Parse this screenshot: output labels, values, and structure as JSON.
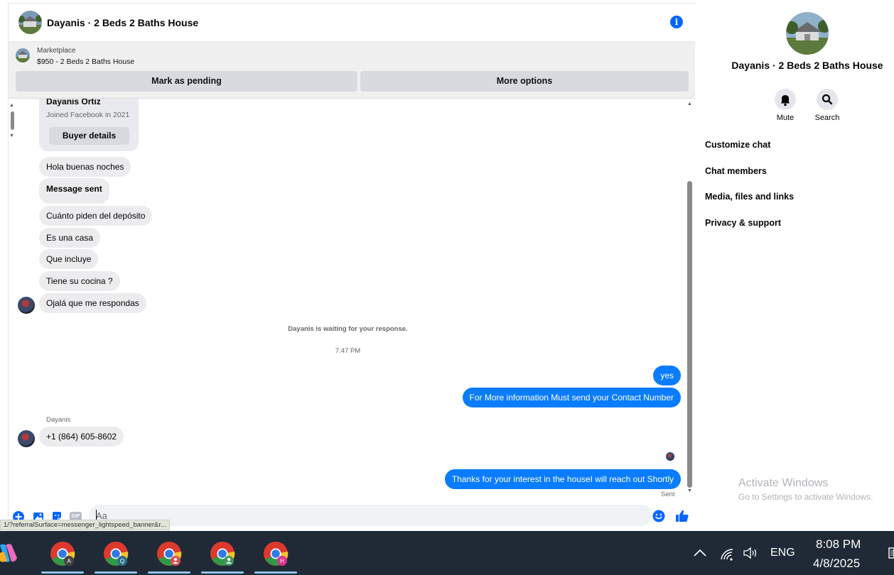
{
  "chat": {
    "title": "Dayanis · 2 Beds 2 Baths House",
    "info_icon": "i"
  },
  "marketplace": {
    "label": "Marketplace",
    "listing": "$950 - 2 Beds 2 Baths House",
    "mark_pending": "Mark as pending",
    "more_options": "More options"
  },
  "buyer_card": {
    "name": "Dayanis Ortiz",
    "joined": "Joined Facebook in 2021",
    "details_button": "Buyer details"
  },
  "messages": {
    "m1": "Hola buenas noches",
    "m2": "Message sent",
    "m3": "Cuánto piden del depósito",
    "m4": "Es una casa",
    "m5": "Que incluye",
    "m6": "Tiene su cocina ?",
    "m7": "Ojalá que me respondas",
    "waiting": "Dayanis is waiting for your response.",
    "time": "7:47 PM",
    "me1": "yes",
    "me2": "For More information Must send your Contact Number",
    "sender": "Dayanis",
    "phone": "+1 (864) 605-8602",
    "me3": "Thanks for your interest in the houseI will reach out Shortly",
    "sent": "Sent"
  },
  "composer": {
    "placeholder": "Aa",
    "gif_label": "GIF"
  },
  "status_url": "1/?referralSurface=messenger_lightspeed_banner&r...",
  "sidebar": {
    "title": "Dayanis · 2 Beds 2 Baths House",
    "mute": "Mute",
    "search": "Search",
    "items": [
      "Customize chat",
      "Chat members",
      "Media, files and links",
      "Privacy & support"
    ]
  },
  "watermark": {
    "title": "Activate Windows",
    "sub": "Go to Settings to activate Windows."
  },
  "taskbar": {
    "profiles": [
      "A",
      "Q",
      "",
      "",
      "H"
    ],
    "lang": "ENG",
    "time": "8:08 PM",
    "date": "4/8/2025"
  },
  "colors": {
    "accent": "#0866ff",
    "my_bubble": "#0a7cff",
    "their_bubble": "#ececee",
    "taskbar": "#1f2a36"
  }
}
